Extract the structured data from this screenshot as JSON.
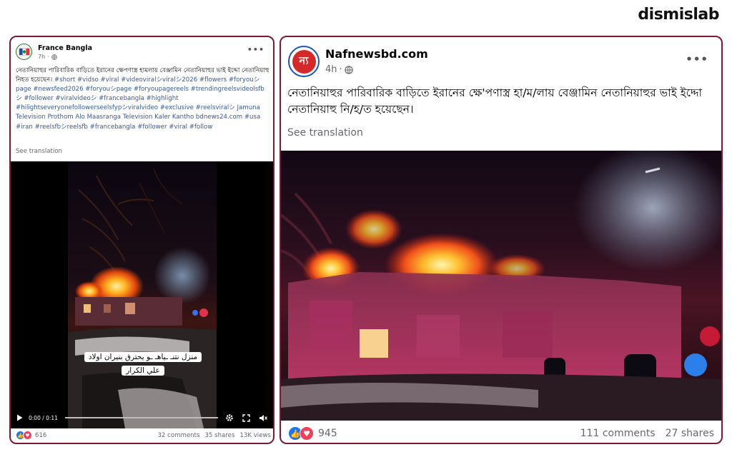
{
  "brand": {
    "logo_text": "dismislab"
  },
  "post1": {
    "page_name": "France Bangla",
    "time": "7h",
    "privacy_icon": "globe-icon",
    "text_main": "নেতানিয়াহুর পারিবারিক বাড়িতে ইরানের ক্ষেপণাস্ত্র হামলায় বেঞ্জামিন নেতানিয়াহুর ভাই ইদ্দো নেতানিয়াহু নিহত হয়েছেন।",
    "hashtags": "#short #vidso #viral #videoviralシviralシ2026 #flowers #foryouシpage #newsfeed2026 #foryouシpage #foryoupagereels #trendingreelsvideolsfbシ #follower #viralvideoシ #francebangla #highlight #hilightseveryonefollowerseelsfypシviralvideo #exclusive #reelsviralシ Jamuna Television    Prothom Alo    Maasranga Television    Kaler Kantho bdnews24.com  #usa #iran #reelsfbシreelsfb #francebangla #follower #viral #follow",
    "see_translation": "See translation",
    "video_caption_line1": "منزل نتنـ ـياهـ ـو يحترق بنيران اولاد",
    "video_caption_line2": "علي الكرار",
    "video_time": "0:00 / 0:11",
    "reactions_count": "616",
    "comments": "32 comments",
    "shares": "35 shares",
    "views": "13K views"
  },
  "post2": {
    "page_name": "Nafnewsbd.com",
    "avatar_glyph": "ন্য",
    "time": "4h",
    "privacy_icon": "globe-icon",
    "text_main": "নেতানিয়াহুর পারিবারিক বাড়িতে ইরানের ক্ষে'পণাস্ত্র হা/ম/লায় বেঞ্জামিন নেতানিয়াহুর ভাই ইদ্দো নেতানিয়াহু নি/হ/ত হয়েছেন।",
    "see_translation": "See translation",
    "reactions_count": "945",
    "comments": "111 comments",
    "shares": "27 shares"
  },
  "colors": {
    "card_border": "#7a1a35",
    "like_blue": "#1877f2",
    "love_red": "#f33e58",
    "hashtag": "#385898"
  }
}
